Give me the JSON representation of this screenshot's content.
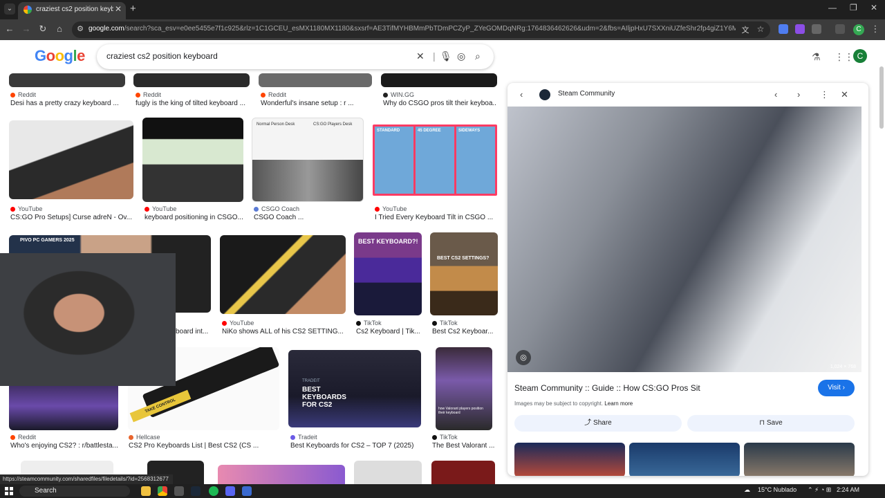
{
  "browser": {
    "tab_title": "craziest cs2 position keyboard",
    "tab_close": "✕",
    "new_tab": "+",
    "url_host": "google.com",
    "url_rest": "/search?sca_esv=e0ee5455e7f1c925&rlz=1C1GCEU_esMX1180MX1180&sxsrf=AE3TifMYHBMmPbTDmPCZyP_ZYeGOMDqNRg:1764836462626&udm=2&fbs=AIljpHxU7SXXniUZfeShr2fp4giZ1Y6MJ25_tmWITc7uy4KI..."
  },
  "search": {
    "query": "craziest cs2 position keyboard",
    "logo_letters": [
      "G",
      "o",
      "o",
      "g",
      "l",
      "e"
    ],
    "avatar_letter": "C"
  },
  "results": [
    {
      "source": "Reddit",
      "caption": "Desi has a pretty crazy keyboard ...",
      "color": "#ff4500"
    },
    {
      "source": "Reddit",
      "caption": "fugly is the king of tilted keyboard ...",
      "color": "#ff4500"
    },
    {
      "source": "Reddit",
      "caption": "Wonderful's insane setup : r ...",
      "color": "#ff4500"
    },
    {
      "source": "WIN.GG",
      "caption": "Why do CSGO pros tilt their keyboa...",
      "color": "#222222"
    },
    {
      "source": "YouTube",
      "caption": "CS:GO Pro Setups] Curse adreN - Ov...",
      "color": "#ff0000"
    },
    {
      "source": "YouTube",
      "caption": "keyboard positioning in CSGO...",
      "color": "#ff0000"
    },
    {
      "source": "CSGO Coach",
      "caption": "CSGO Coach ...",
      "color": "#5b7bd5"
    },
    {
      "source": "YouTube",
      "caption": "I Tried Every Keyboard Tilt in CSGO ...",
      "color": "#ff0000"
    },
    {
      "source": "",
      "caption": "board int...",
      "color": "#ffffff"
    },
    {
      "source": "YouTube",
      "caption": "NiKo shows ALL of his CS2 SETTING...",
      "color": "#ff0000"
    },
    {
      "source": "TikTok",
      "caption": "Cs2 Keyboard | Tik...",
      "color": "#111111"
    },
    {
      "source": "TikTok",
      "caption": "Best Cs2 Keyboar...",
      "color": "#111111"
    },
    {
      "source": "Reddit",
      "caption": "Who's enjoying CS2? : r/battlesta...",
      "color": "#ff4500"
    },
    {
      "source": "Hellcase",
      "caption": "CS2 Pro Keyboards List | Best CS2 (CS ...",
      "color": "#e8652e"
    },
    {
      "source": "Tradeit",
      "caption": "Best Keyboards for CS2 – TOP 7 (2025)",
      "color": "#6b5be6"
    },
    {
      "source": "TikTok",
      "caption": "The Best Valorant ...",
      "color": "#111111"
    }
  ],
  "thumb_text": {
    "stream_banner": "PIVO PC GAMERS 2025",
    "best_keyboard": "BEST KEYBOARD?!",
    "csgo_settings": "BEST CS2 SETTINGS?",
    "tradeit_title": "BEST KEYBOARDS FOR CS2",
    "tradeit_brand": "TRADEIT",
    "tilt_labels": [
      "STANDARD",
      "45 DEGREE",
      "SIDEWAYS"
    ],
    "take_control": "TAKE CONTROL",
    "desk_labels": [
      "Normal Person Desk",
      "CS:GO Players Desk"
    ],
    "valorant_text": "how Valorant players position their keyboard"
  },
  "panel": {
    "source": "Steam Community",
    "title": "Steam Community :: Guide :: How CS:GO Pros Sit",
    "visit_label": "Visit",
    "copyright_text": "Images may be subject to copyright.",
    "learn_more": "Learn more",
    "share_label": "Share",
    "save_label": "Save",
    "resolution": "1,024 × 768"
  },
  "status_url": "https://steamcommunity.com/sharedfiles/filedetails/?id=2568312677",
  "taskbar": {
    "search_label": "Search",
    "weather": "15°C Nublado",
    "time": "2:24 AM"
  }
}
